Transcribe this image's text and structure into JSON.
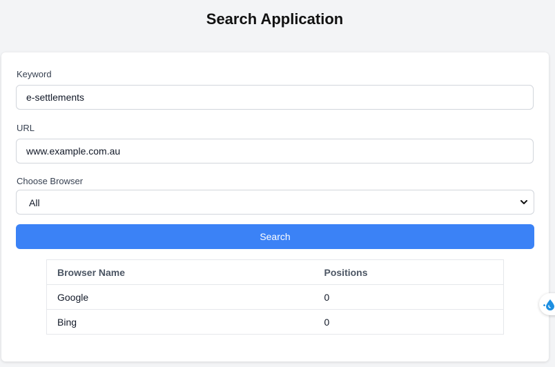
{
  "page": {
    "title": "Search Application"
  },
  "form": {
    "keyword": {
      "label": "Keyword",
      "value": "e-settlements"
    },
    "url": {
      "label": "URL",
      "value": "www.example.com.au"
    },
    "browser": {
      "label": "Choose Browser",
      "selected": "All"
    },
    "search_button_label": "Search"
  },
  "results": {
    "columns": [
      "Browser Name",
      "Positions"
    ],
    "rows": [
      {
        "browser": "Google",
        "position": "0"
      },
      {
        "browser": "Bing",
        "position": "0"
      }
    ]
  },
  "colors": {
    "accent": "#3b82f6",
    "background": "#f3f4f6"
  },
  "icons": {
    "select_arrow": "chevron-down-icon",
    "widget": "droplet-icon"
  }
}
